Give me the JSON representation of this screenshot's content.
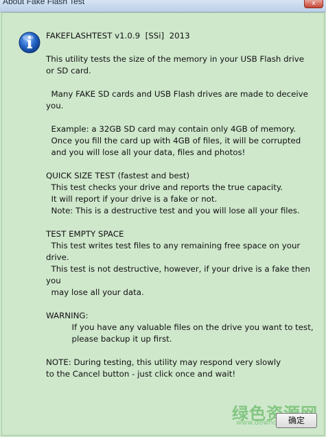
{
  "window": {
    "title": "About Fake Flash Test",
    "close_glyph": "x"
  },
  "icon": "info-icon",
  "body": {
    "header": "FAKEFLASHTEST v1.0.9  [SSi]  2013",
    "lines": [
      "This utility tests the size of the memory in your USB Flash drive",
      "or SD card.",
      "",
      "  Many FAKE SD cards and USB Flash drives are made to deceive",
      "you.",
      "",
      "  Example: a 32GB SD card may contain only 4GB of memory.",
      "  Once you fill the card up with 4GB of files, it will be corrupted",
      "  and you will lose all your data, files and photos!",
      "",
      "QUICK SIZE TEST (fastest and best)",
      "  This test checks your drive and reports the true capacity.",
      "  It will report if your drive is a fake or not.",
      "  Note: This is a destructive test and you will lose all your files.",
      "",
      "TEST EMPTY SPACE",
      "  This test writes test files to any remaining free space on your",
      "drive.",
      "  This test is not destructive, however, if your drive is a fake then",
      "you",
      "  may lose all your data.",
      "",
      "WARNING:",
      "          If you have any valuable files on the drive you want to test,",
      "          please backup it up first.",
      "",
      "NOTE: During testing, this utility may respond very slowly",
      "to the Cancel button - just click once and wait!"
    ]
  },
  "buttons": {
    "ok_label": "确定"
  },
  "watermark": {
    "brand": "绿色资源网",
    "url": "www.downcc.com"
  },
  "colors": {
    "background": "#cfe8cc",
    "icon_blue": "#1f5fbf"
  }
}
